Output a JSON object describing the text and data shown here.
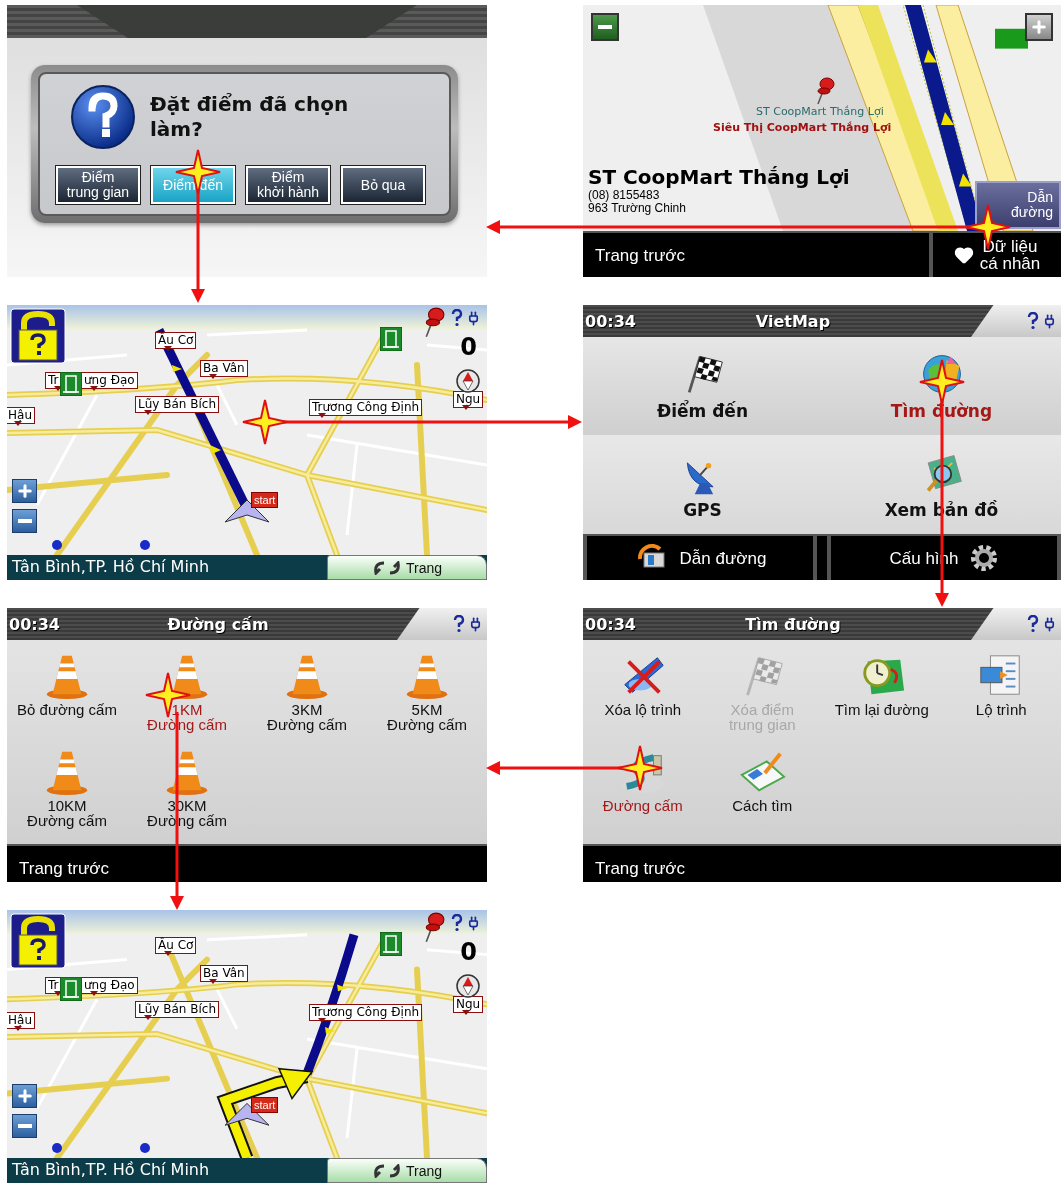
{
  "screens": [
    {
      "kind": "dialog",
      "question": "Đặt điểm đã chọn làm?",
      "buttons": [
        {
          "label": "Điểm\ntrung gian",
          "selected": false
        },
        {
          "label": "Điểm đến",
          "selected": true
        },
        {
          "label": "Điểm\nkhởi hành",
          "selected": false
        },
        {
          "label": "Bỏ qua",
          "selected": false
        }
      ]
    },
    {
      "kind": "place",
      "map_labels": [
        "ST CoopMart Thắng Lợi",
        "Siêu Thị CoopMart Thắng Lợi"
      ],
      "title": "ST CoopMart Thắng Lợi",
      "phone": "(08) 8155483",
      "address": "963 Trường Chinh",
      "route_button": "Dẫn\nđường",
      "back_button": "Trang trước",
      "favorites_button": "Dữ liệu\ncá nhân"
    },
    {
      "kind": "map",
      "streets": [
        "Âu Cơ",
        "Ba Vân",
        "Tr",
        "ưng Đạo",
        "Lũy Bán Bích",
        "Hậu",
        "Trương Công Định",
        "Ngu"
      ],
      "speed": "0",
      "start_flag": "start",
      "location": "Tân Bình,TP. Hồ Chí Minh",
      "page_button": "Trang"
    },
    {
      "kind": "menu",
      "time": "00:34",
      "title": "VietMap",
      "items": [
        {
          "kind": "flag",
          "label": "Điểm đến",
          "selected": false
        },
        {
          "kind": "globe",
          "label": "Tìm đường",
          "selected": true
        },
        {
          "kind": "dish",
          "label": "GPS",
          "selected": false
        },
        {
          "kind": "mapglass",
          "label": "Xem bản đồ",
          "selected": false
        }
      ],
      "bottom_buttons": [
        {
          "kind": "route",
          "label": "Dẫn đường"
        },
        {
          "kind": "gear",
          "label": "Cấu hình"
        }
      ]
    },
    {
      "kind": "grid",
      "time": "00:34",
      "title": "Đường cấm",
      "items": [
        {
          "kind": "cone",
          "label": "Bỏ đường cấm",
          "selected": false,
          "disabled": false
        },
        {
          "kind": "cone",
          "label": "1KM\nĐường cấm",
          "selected": true,
          "disabled": false
        },
        {
          "kind": "cone",
          "label": "3KM\nĐường cấm",
          "selected": false,
          "disabled": false
        },
        {
          "kind": "cone",
          "label": "5KM\nĐường cấm",
          "selected": false,
          "disabled": false
        },
        {
          "kind": "cone",
          "label": "10KM\nĐường cấm",
          "selected": false,
          "disabled": false
        },
        {
          "kind": "cone",
          "label": "30KM\nĐường cấm",
          "selected": false,
          "disabled": false
        }
      ],
      "back_button": "Trang trước"
    },
    {
      "kind": "grid",
      "time": "00:34",
      "title": "Tìm đường",
      "items": [
        {
          "kind": "erase",
          "label": "Xóa lộ trình",
          "selected": false,
          "disabled": false
        },
        {
          "kind": "flag",
          "label": "Xóa điểm\ntrung gian",
          "selected": false,
          "disabled": true
        },
        {
          "kind": "clockmap",
          "label": "Tìm lại đường",
          "selected": false,
          "disabled": false
        },
        {
          "kind": "list",
          "label": "Lộ trình",
          "selected": false,
          "disabled": false
        },
        {
          "kind": "road",
          "label": "Đường cấm",
          "selected": true,
          "disabled": false
        },
        {
          "kind": "notepad",
          "label": "Cách tìm",
          "selected": false,
          "disabled": false
        }
      ],
      "back_button": "Trang trước"
    },
    {
      "kind": "map_turn",
      "streets": [
        "Âu Cơ",
        "Ba Vân",
        "Tr",
        "ưng Đạo",
        "Lũy Bán Bích",
        "Hậu",
        "Trương Công Định",
        "Ngu"
      ],
      "speed": "0",
      "start_flag": "start",
      "location": "Tân Bình,TP. Hồ Chí Minh",
      "page_button": "Trang"
    }
  ]
}
